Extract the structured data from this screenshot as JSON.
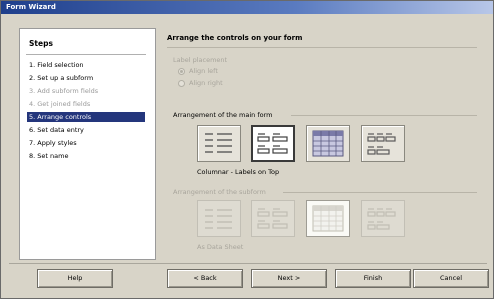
{
  "window": {
    "title": "Form Wizard"
  },
  "steps": {
    "title": "Steps",
    "items": [
      {
        "label": "1. Field selection",
        "state": "normal"
      },
      {
        "label": "2. Set up a subform",
        "state": "normal"
      },
      {
        "label": "3. Add subform fields",
        "state": "disabled"
      },
      {
        "label": "4. Get joined fields",
        "state": "disabled"
      },
      {
        "label": "5. Arrange controls",
        "state": "active"
      },
      {
        "label": "6. Set data entry",
        "state": "normal"
      },
      {
        "label": "7. Apply styles",
        "state": "normal"
      },
      {
        "label": "8. Set name",
        "state": "normal"
      }
    ]
  },
  "content": {
    "title": "Arrange the controls on your form",
    "label_alignment": {
      "label": "Label placement",
      "options": [
        {
          "label": "Align left",
          "selected": true
        },
        {
          "label": "Align right",
          "selected": false
        }
      ]
    },
    "main_form": {
      "label": "Arrangement of the main form",
      "selected_caption": "Columnar - Labels on Top",
      "layouts": [
        {
          "name": "columnar-labels-left",
          "selected": false
        },
        {
          "name": "columnar-labels-on-top",
          "selected": true
        },
        {
          "name": "as-data-sheet",
          "selected": false
        },
        {
          "name": "in-blocks-labels-above",
          "selected": false
        }
      ]
    },
    "sub_form": {
      "label": "Arrangement of the subform",
      "selected_caption": "As Data Sheet",
      "layouts": [
        {
          "name": "columnar-labels-left",
          "selected": false
        },
        {
          "name": "columnar-labels-on-top",
          "selected": false
        },
        {
          "name": "as-data-sheet",
          "selected": true
        },
        {
          "name": "in-blocks-labels-above",
          "selected": false
        }
      ]
    }
  },
  "buttons": {
    "help": "Help",
    "back": "< Back",
    "next": "Next >",
    "finish": "Finish",
    "cancel": "Cancel"
  },
  "colors": {
    "active_step_bg": "#24367c",
    "titlebar": "#1f3f8c",
    "dialog_bg": "#d8d4c8"
  }
}
